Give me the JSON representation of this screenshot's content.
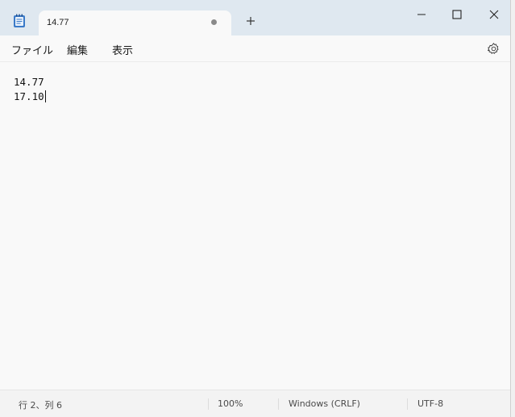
{
  "window": {
    "tab_title": "14.77"
  },
  "menu": {
    "file": "ファイル",
    "edit": "編集",
    "view": "表示"
  },
  "editor": {
    "lines": [
      "14.77",
      "17.10"
    ]
  },
  "status": {
    "position": "行 2、列 6",
    "zoom": "100%",
    "line_ending": "Windows (CRLF)",
    "encoding": "UTF-8"
  },
  "icons": {
    "app": "notepad-icon",
    "settings": "gear-icon",
    "minimize": "minimize-icon",
    "maximize": "maximize-icon",
    "close": "close-icon",
    "new_tab": "plus-icon",
    "unsaved": "unsaved-dot-icon"
  },
  "colors": {
    "titlebar": "#dfe8f0",
    "editor_bg": "#f9f9f9",
    "statusbar": "#f3f3f3",
    "icon_accent": "#3b7ac8"
  }
}
